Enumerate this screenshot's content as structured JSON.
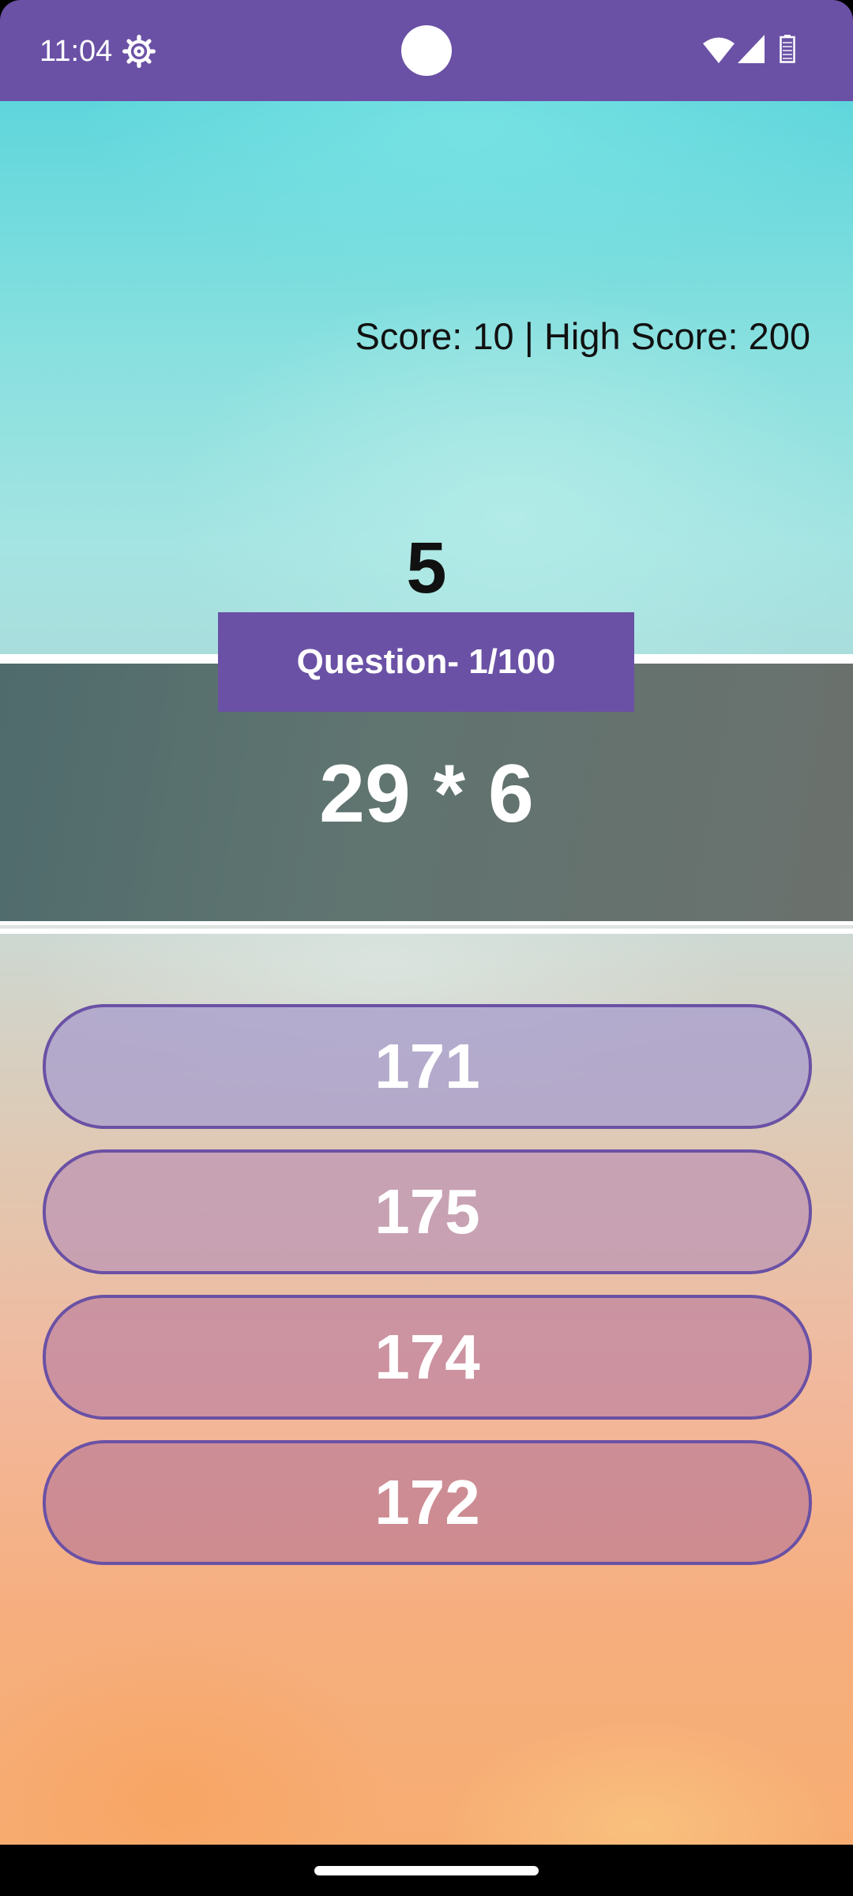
{
  "status_bar": {
    "time": "11:04",
    "icons": [
      "gear-icon",
      "camera-cutout",
      "wifi-icon",
      "signal-icon",
      "battery-icon"
    ]
  },
  "game": {
    "score_text": "Score: 10 | High Score: 200",
    "timer_value": "5",
    "question_label": "Question- 1/100",
    "question_expression": "29 * 6",
    "answers": [
      {
        "label": "171",
        "color": "#b3a9c6"
      },
      {
        "label": "175",
        "color": "#c4a0b1"
      },
      {
        "label": "174",
        "color": "#c8929b"
      },
      {
        "label": "172",
        "color": "#c98785"
      }
    ]
  },
  "colors": {
    "accent": "#6a51a5"
  }
}
